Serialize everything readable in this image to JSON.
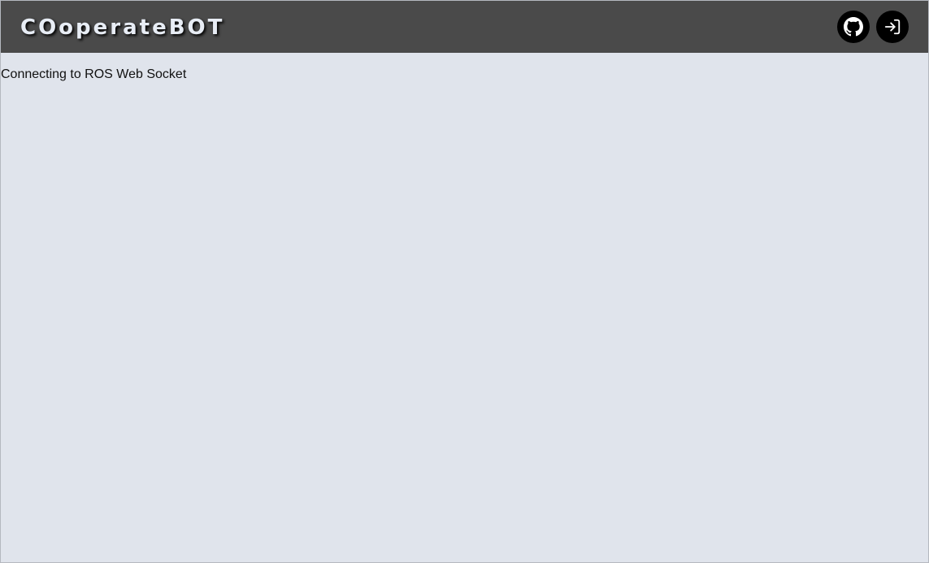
{
  "navbar": {
    "brand": "COoperateBOT",
    "buttons": [
      {
        "icon": "github-icon"
      },
      {
        "icon": "login-icon"
      }
    ]
  },
  "main": {
    "status_text": "Connecting to ROS Web Socket"
  },
  "colors": {
    "navbar_bg": "#4a4a4a",
    "page_bg": "#e0e4ec",
    "button_bg": "#000000",
    "brand_text": "#e8edf5"
  }
}
